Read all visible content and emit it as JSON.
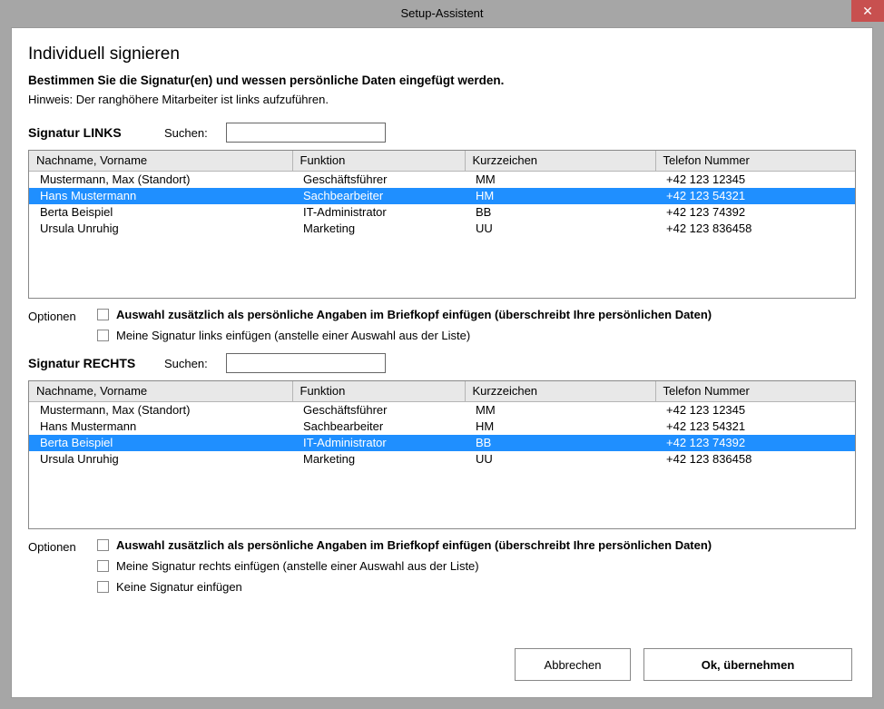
{
  "window": {
    "title": "Setup-Assistent",
    "close_label": "✕"
  },
  "heading": "Individuell signieren",
  "subtitle": "Bestimmen Sie die Signatur(en) und wessen persönliche Daten eingefügt werden.",
  "hint": "Hinweis: Der ranghöhere Mitarbeiter ist links aufzuführen.",
  "sections": {
    "left": {
      "title": "Signatur LINKS",
      "search_label": "Suchen:",
      "search_value": ""
    },
    "right": {
      "title": "Signatur RECHTS",
      "search_label": "Suchen:",
      "search_value": ""
    }
  },
  "columns": {
    "name": "Nachname, Vorname",
    "func": "Funktion",
    "kurz": "Kurzzeichen",
    "tel": "Telefon Nummer"
  },
  "table_left": {
    "selected_index": 1,
    "rows": [
      {
        "name": "Mustermann, Max (Standort)",
        "func": "Geschäftsführer",
        "kurz": "MM",
        "tel": "+42 123 12345"
      },
      {
        "name": "Hans Mustermann",
        "func": "Sachbearbeiter",
        "kurz": "HM",
        "tel": "+42 123 54321"
      },
      {
        "name": "Berta Beispiel",
        "func": "IT-Administrator",
        "kurz": "BB",
        "tel": "+42 123 74392"
      },
      {
        "name": "Ursula Unruhig",
        "func": "Marketing",
        "kurz": "UU",
        "tel": "+42 123 836458"
      }
    ]
  },
  "table_right": {
    "selected_index": 2,
    "rows": [
      {
        "name": "Mustermann, Max (Standort)",
        "func": "Geschäftsführer",
        "kurz": "MM",
        "tel": "+42 123 12345"
      },
      {
        "name": "Hans Mustermann",
        "func": "Sachbearbeiter",
        "kurz": "HM",
        "tel": "+42 123 54321"
      },
      {
        "name": "Berta Beispiel",
        "func": "IT-Administrator",
        "kurz": "BB",
        "tel": "+42 123 74392"
      },
      {
        "name": "Ursula Unruhig",
        "func": "Marketing",
        "kurz": "UU",
        "tel": "+42 123 836458"
      }
    ]
  },
  "options_label": "Optionen",
  "options_left": [
    {
      "bold": true,
      "text": "Auswahl zusätzlich  als persönliche Angaben im Briefkopf einfügen (überschreibt Ihre persönlichen Daten)"
    },
    {
      "bold": false,
      "text": "Meine Signatur links einfügen (anstelle einer Auswahl aus der Liste)"
    }
  ],
  "options_right": [
    {
      "bold": true,
      "text": "Auswahl zusätzlich  als persönliche Angaben im Briefkopf einfügen (überschreibt Ihre persönlichen Daten)"
    },
    {
      "bold": false,
      "text": "Meine Signatur rechts einfügen (anstelle einer Auswahl aus der Liste)"
    },
    {
      "bold": false,
      "text": "Keine Signatur einfügen"
    }
  ],
  "buttons": {
    "cancel": "Abbrechen",
    "ok": "Ok, übernehmen"
  }
}
